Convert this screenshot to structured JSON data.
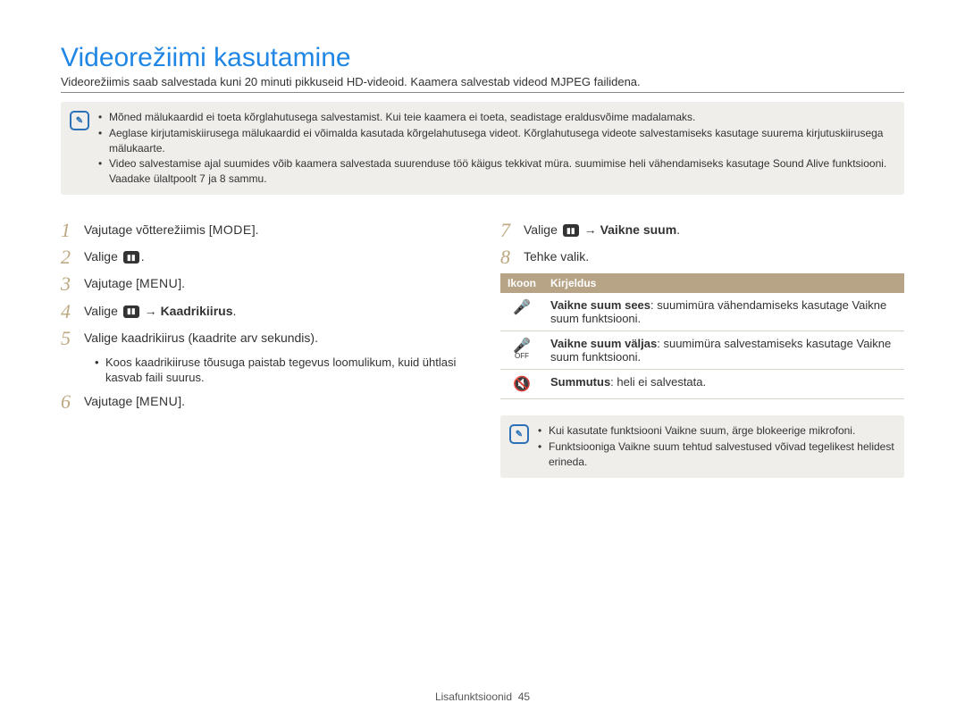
{
  "title": "Videorežiimi kasutamine",
  "subtitle": "Videorežiimis saab salvestada kuni 20 minuti pikkuseid HD-videoid. Kaamera salvestab videod MJPEG failidena.",
  "warnings": [
    "Mõned mälukaardid ei toeta kõrglahutusega salvestamist. Kui teie kaamera ei toeta, seadistage eraldusvõime madalamaks.",
    "Aeglase kirjutamiskiirusega mälukaardid ei võimalda kasutada kõrgelahutusega videot. Kõrglahutusega videote salvestamiseks kasutage suurema kirjutuskiirusega mälukaarte.",
    "Video salvestamise ajal suumides võib kaamera salvestada suurenduse töö käigus tekkivat müra. suumimise heli vähendamiseks kasutage Sound Alive funktsiooni. Vaadake ülaltpoolt 7 ja 8 sammu."
  ],
  "steps_left": [
    {
      "n": "1",
      "text_before": "Vajutage võtterežiimis [",
      "kbd": "MODE",
      "text_after": "]."
    },
    {
      "n": "2",
      "text_before": "Valige ",
      "icon": "video",
      "text_after": "."
    },
    {
      "n": "3",
      "text_before": "Vajutage [",
      "kbd": "MENU",
      "text_after": "]."
    },
    {
      "n": "4",
      "text_before": "Valige ",
      "icon": "video",
      "arrow": " → ",
      "bold": "Kaadrikiirus",
      "text_after": "."
    },
    {
      "n": "5",
      "text_before": "Valige kaadrikiirus (kaadrite arv sekundis).",
      "sub": "Koos kaadrikiiruse tõusuga paistab tegevus loomulikum, kuid ühtlasi kasvab faili suurus."
    },
    {
      "n": "6",
      "text_before": "Vajutage [",
      "kbd": "MENU",
      "text_after": "]."
    }
  ],
  "steps_right": [
    {
      "n": "7",
      "text_before": "Valige ",
      "icon": "video",
      "arrow": " → ",
      "bold": "Vaikne suum",
      "text_after": "."
    },
    {
      "n": "8",
      "text_before": "Tehke valik."
    }
  ],
  "table": {
    "head": {
      "c1": "Ikoon",
      "c2": "Kirjeldus"
    },
    "rows": [
      {
        "icon": "mic",
        "title": "Vaikne suum sees",
        "desc": ": suumimüra vähendamiseks kasutage Vaikne suum funktsiooni."
      },
      {
        "icon": "mic-off",
        "title": "Vaikne suum väljas",
        "desc": ": suumimüra salvestamiseks kasutage Vaikne suum funktsiooni."
      },
      {
        "icon": "mic-mute",
        "title": "Summutus",
        "desc": ": heli ei salvestata."
      }
    ]
  },
  "notes": [
    "Kui kasutate funktsiooni Vaikne suum, ärge blokeerige mikrofoni.",
    "Funktsiooniga Vaikne suum tehtud salvestused võivad tegelikest helidest erineda."
  ],
  "footer": {
    "section": "Lisafunktsioonid",
    "page": "45"
  }
}
